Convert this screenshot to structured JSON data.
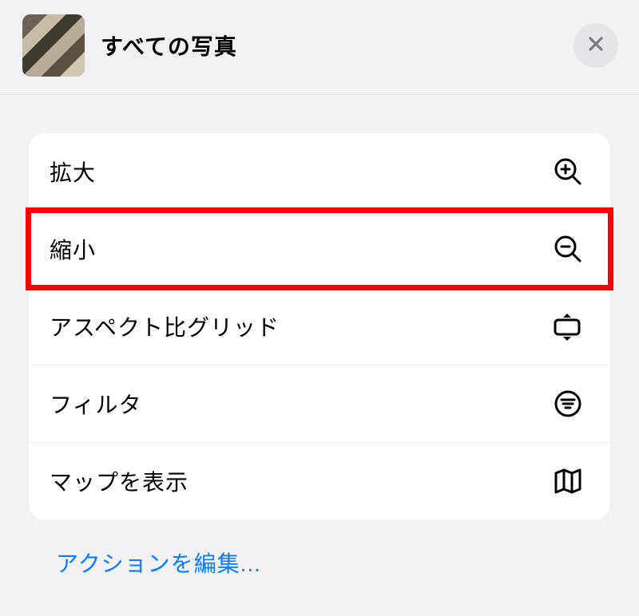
{
  "header": {
    "title": "すべての写真"
  },
  "menu": {
    "items": [
      {
        "label": "拡大",
        "icon": "zoom-in"
      },
      {
        "label": "縮小",
        "icon": "zoom-out",
        "highlighted": true
      },
      {
        "label": "アスペクト比グリッド",
        "icon": "aspect"
      },
      {
        "label": "フィルタ",
        "icon": "filter"
      },
      {
        "label": "マップを表示",
        "icon": "map"
      }
    ]
  },
  "footer": {
    "edit_actions": "アクションを編集..."
  }
}
